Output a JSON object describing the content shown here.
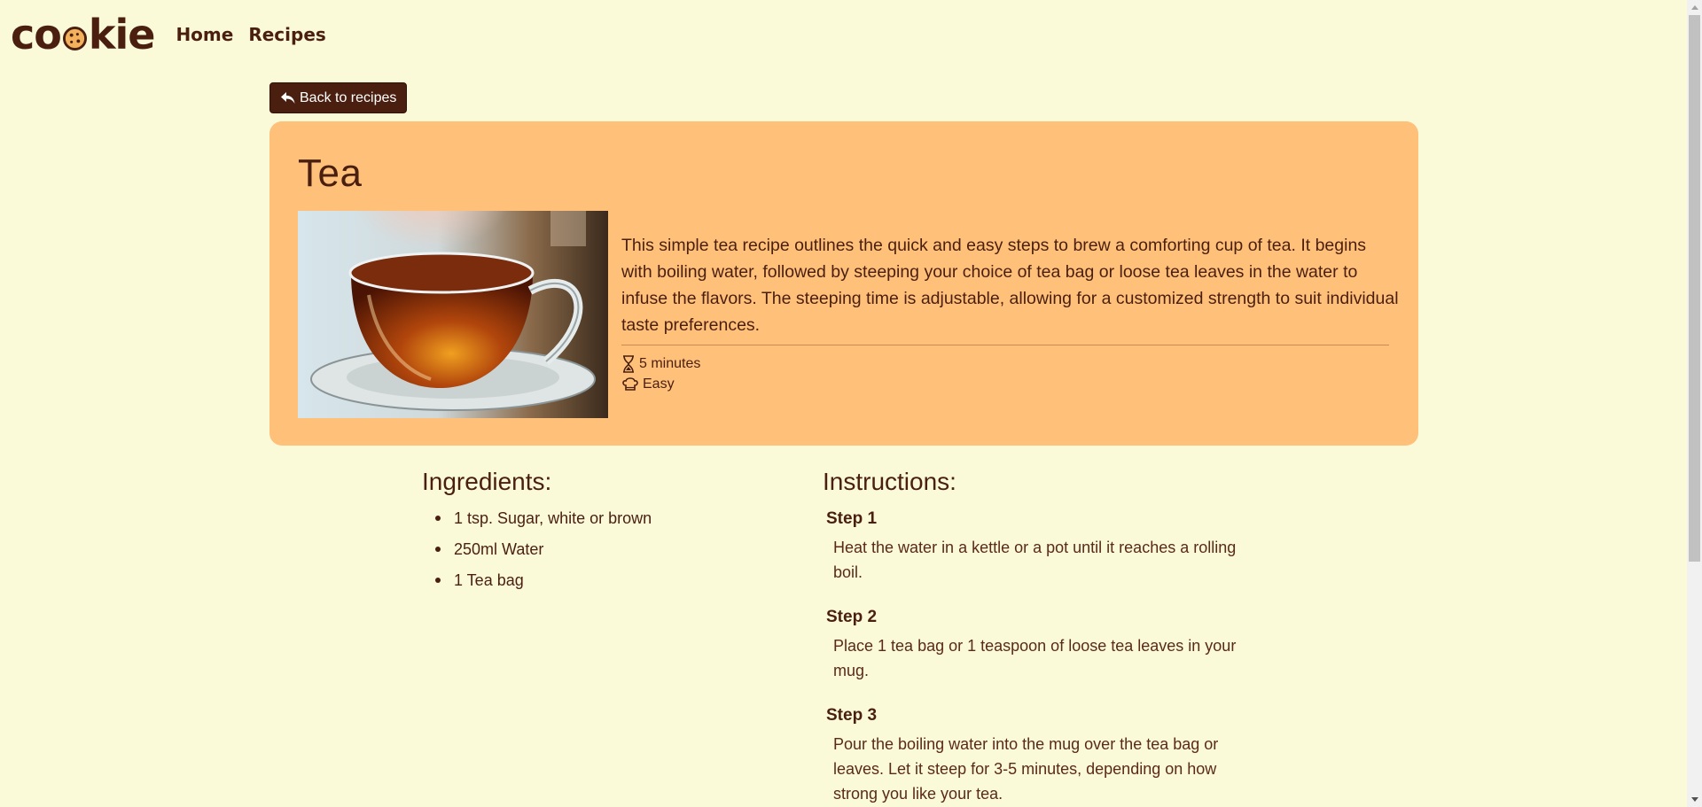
{
  "nav": {
    "logo_pre": "co",
    "logo_post": "kie",
    "links": [
      {
        "label": "Home"
      },
      {
        "label": "Recipes"
      }
    ]
  },
  "back_button": {
    "label": "Back to recipes"
  },
  "recipe": {
    "title": "Tea",
    "description": "This simple tea recipe outlines the quick and easy steps to brew a comforting cup of tea. It begins with boiling water, followed by steeping your choice of tea bag or loose tea leaves in the water to infuse the flavors. The steeping time is adjustable, allowing for a customized strength to suit individual taste preferences.",
    "time": "5 minutes",
    "difficulty": "Easy"
  },
  "ingredients": {
    "title": "Ingredients:",
    "items": [
      "1 tsp. Sugar, white or brown",
      "250ml Water",
      "1 Tea bag"
    ]
  },
  "instructions": {
    "title": "Instructions:",
    "steps": [
      {
        "title": "Step 1",
        "text": "Heat the water in a kettle or a pot until it reaches a rolling boil."
      },
      {
        "title": "Step 2",
        "text": "Place 1 tea bag or 1 teaspoon of loose tea leaves in your mug."
      },
      {
        "title": "Step 3",
        "text": "Pour the boiling water into the mug over the tea bag or leaves. Let it steep for 3-5 minutes, depending on how strong you like your tea."
      }
    ]
  },
  "colors": {
    "background": "#fafad9",
    "brand_brown": "#4a1f10",
    "card": "#ffc07a"
  }
}
